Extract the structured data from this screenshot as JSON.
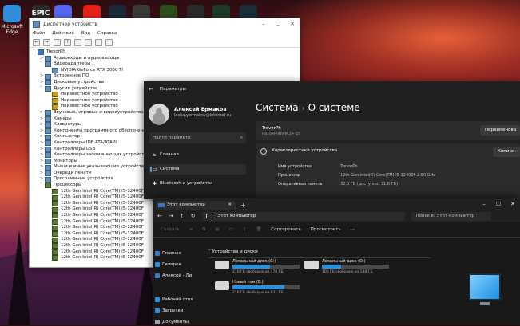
{
  "desktop": {
    "icons": [
      {
        "name": "edge-icon",
        "label": "Microsoft Edge",
        "color": "#2f8fd8"
      },
      {
        "name": "epic-games-icon",
        "label": "",
        "text": "EPIC",
        "color": "#2a2a2a"
      },
      {
        "name": "discord-icon",
        "label": "",
        "color": "#5865f2"
      },
      {
        "name": "youtube-icon",
        "label": "",
        "color": "#e62117"
      },
      {
        "name": "steam-icon",
        "label": "",
        "color": "#1b2838"
      },
      {
        "name": "davinci-icon",
        "label": "",
        "color": "#3a3a3a"
      },
      {
        "name": "nvidia-icon",
        "label": "",
        "color": "#2d4d1a"
      },
      {
        "name": "app-icon",
        "label": "",
        "color": "#2b2b2b"
      },
      {
        "name": "app2-icon",
        "label": "",
        "color": "#1e3a2a"
      },
      {
        "name": "app3-icon",
        "label": "",
        "color": "#1a2f3a"
      }
    ]
  },
  "device_manager": {
    "title": "Диспетчер устройств",
    "menu": [
      "Файл",
      "Действие",
      "Вид",
      "Справка"
    ],
    "tree": [
      {
        "label": "TrevorPh",
        "level": 0,
        "arrow": "˅",
        "icon": "root"
      },
      {
        "label": "Аудиовходы и аудиовыходы",
        "level": 1,
        "arrow": ">",
        "icon": ""
      },
      {
        "label": "Видеоадаптеры",
        "level": 1,
        "arrow": "˅",
        "icon": ""
      },
      {
        "label": "NVIDIA GeForce RTX 3060 Ti",
        "level": 2,
        "arrow": "",
        "icon": ""
      },
      {
        "label": "Встроенное ПО",
        "level": 1,
        "arrow": ">",
        "icon": ""
      },
      {
        "label": "Дисковые устройства",
        "level": 1,
        "arrow": ">",
        "icon": ""
      },
      {
        "label": "Другие устройства",
        "level": 1,
        "arrow": "˅",
        "icon": ""
      },
      {
        "label": "Неизвестное устройство",
        "level": 2,
        "arrow": "",
        "icon": "warn"
      },
      {
        "label": "Неизвестное устройство",
        "level": 2,
        "arrow": "",
        "icon": "warn"
      },
      {
        "label": "Неизвестное устройство",
        "level": 2,
        "arrow": "",
        "icon": "warn"
      },
      {
        "label": "Звуковые, игровые и видеоустройства",
        "level": 1,
        "arrow": ">",
        "icon": ""
      },
      {
        "label": "Камеры",
        "level": 1,
        "arrow": ">",
        "icon": ""
      },
      {
        "label": "Клавиатуры",
        "level": 1,
        "arrow": ">",
        "icon": ""
      },
      {
        "label": "Компоненты программного обеспечения",
        "level": 1,
        "arrow": ">",
        "icon": ""
      },
      {
        "label": "Компьютер",
        "level": 1,
        "arrow": ">",
        "icon": ""
      },
      {
        "label": "Контроллеры IDE ATA/ATAPI",
        "level": 1,
        "arrow": ">",
        "icon": ""
      },
      {
        "label": "Контроллеры USB",
        "level": 1,
        "arrow": ">",
        "icon": ""
      },
      {
        "label": "Контроллеры запоминающих устройств",
        "level": 1,
        "arrow": ">",
        "icon": ""
      },
      {
        "label": "Мониторы",
        "level": 1,
        "arrow": ">",
        "icon": ""
      },
      {
        "label": "Мыши и иные указывающие устройства",
        "level": 1,
        "arrow": ">",
        "icon": ""
      },
      {
        "label": "Очереди печати",
        "level": 1,
        "arrow": ">",
        "icon": ""
      },
      {
        "label": "Программные устройства",
        "level": 1,
        "arrow": ">",
        "icon": ""
      },
      {
        "label": "Процессоры",
        "level": 1,
        "arrow": "˅",
        "icon": "cpu"
      },
      {
        "label": "12th Gen Intel(R) Core(TM) i5-12400F",
        "level": 2,
        "arrow": "",
        "icon": "cpu"
      },
      {
        "label": "12th Gen Intel(R) Core(TM) i5-12400F",
        "level": 2,
        "arrow": "",
        "icon": "cpu"
      },
      {
        "label": "12th Gen Intel(R) Core(TM) i5-12400F",
        "level": 2,
        "arrow": "",
        "icon": "cpu"
      },
      {
        "label": "12th Gen Intel(R) Core(TM) i5-12400F",
        "level": 2,
        "arrow": "",
        "icon": "cpu"
      },
      {
        "label": "12th Gen Intel(R) Core(TM) i5-12400F",
        "level": 2,
        "arrow": "",
        "icon": "cpu"
      },
      {
        "label": "12th Gen Intel(R) Core(TM) i5-12400F",
        "level": 2,
        "arrow": "",
        "icon": "cpu"
      },
      {
        "label": "12th Gen Intel(R) Core(TM) i5-12400F",
        "level": 2,
        "arrow": "",
        "icon": "cpu"
      },
      {
        "label": "12th Gen Intel(R) Core(TM) i5-12400F",
        "level": 2,
        "arrow": "",
        "icon": "cpu"
      },
      {
        "label": "12th Gen Intel(R) Core(TM) i5-12400F",
        "level": 2,
        "arrow": "",
        "icon": "cpu"
      },
      {
        "label": "12th Gen Intel(R) Core(TM) i5-12400F",
        "level": 2,
        "arrow": "",
        "icon": "cpu"
      },
      {
        "label": "12th Gen Intel(R) Core(TM) i5-12400F",
        "level": 2,
        "arrow": "",
        "icon": "cpu"
      },
      {
        "label": "12th Gen Intel(R) Core(TM) i5-12400F",
        "level": 2,
        "arrow": "",
        "icon": "cpu"
      }
    ]
  },
  "settings": {
    "title": "Параметры",
    "user_name": "Алексей Ермаков",
    "user_email": "lesha-yermakov@internet.ru",
    "search_placeholder": "Найти параметр",
    "nav": [
      {
        "label": "Главная",
        "icon": "⌂",
        "selected": false
      },
      {
        "label": "Система",
        "icon": "▭",
        "selected": true
      },
      {
        "label": "Bluetooth и устройства",
        "icon": "✱",
        "selected": false
      }
    ],
    "breadcrumb_parent": "Система",
    "breadcrumb_current": "О системе",
    "pc_name": "TrevorPh",
    "pc_model": "H610M-HDV/M.2+ D5",
    "rename_button": "Переименова",
    "specs_header": "Характеристики устройства",
    "copy_button": "Копиро",
    "specs": [
      {
        "key": "Имя устройства",
        "value": "TrevorPh"
      },
      {
        "key": "Процессор",
        "value": "12th Gen Intel(R) Core(TM) i5-12400F   2.50 GHz"
      },
      {
        "key": "Оперативная память",
        "value": "32,0 ГБ (доступно: 31,8 ГБ)"
      }
    ]
  },
  "explorer": {
    "tab_title": "Этот компьютер",
    "address": "Этот компьютер",
    "search_placeholder": "Поиск в: Этот компьютер",
    "commands": [
      "Создать",
      "Сортировать",
      "Просмотреть"
    ],
    "sidebar": [
      {
        "label": "Главная",
        "color": "#3a78c4"
      },
      {
        "label": "Галерея",
        "color": "#2b8fd9"
      },
      {
        "label": "Алексей - Ли",
        "color": "#3a78c4"
      },
      {
        "label": "Рабочий стол",
        "color": "#2b8fd9"
      },
      {
        "label": "Загрузки",
        "color": "#2b8fd9"
      },
      {
        "label": "Документы",
        "color": "#9aa4b0"
      }
    ],
    "group_label": "Устройства и диски",
    "drives": [
      {
        "name": "Локальный диск (C:)",
        "free": "210 ГБ свободно из 476 ГБ",
        "used_fraction": 0.56
      },
      {
        "name": "Локальный диск (D:)",
        "free": "106 ГБ свободно из 148 ГБ",
        "used_fraction": 0.28
      },
      {
        "name": "Новый том (E:)",
        "free": "216 ГБ свободно из 931 ГБ",
        "used_fraction": 0.77
      }
    ]
  }
}
